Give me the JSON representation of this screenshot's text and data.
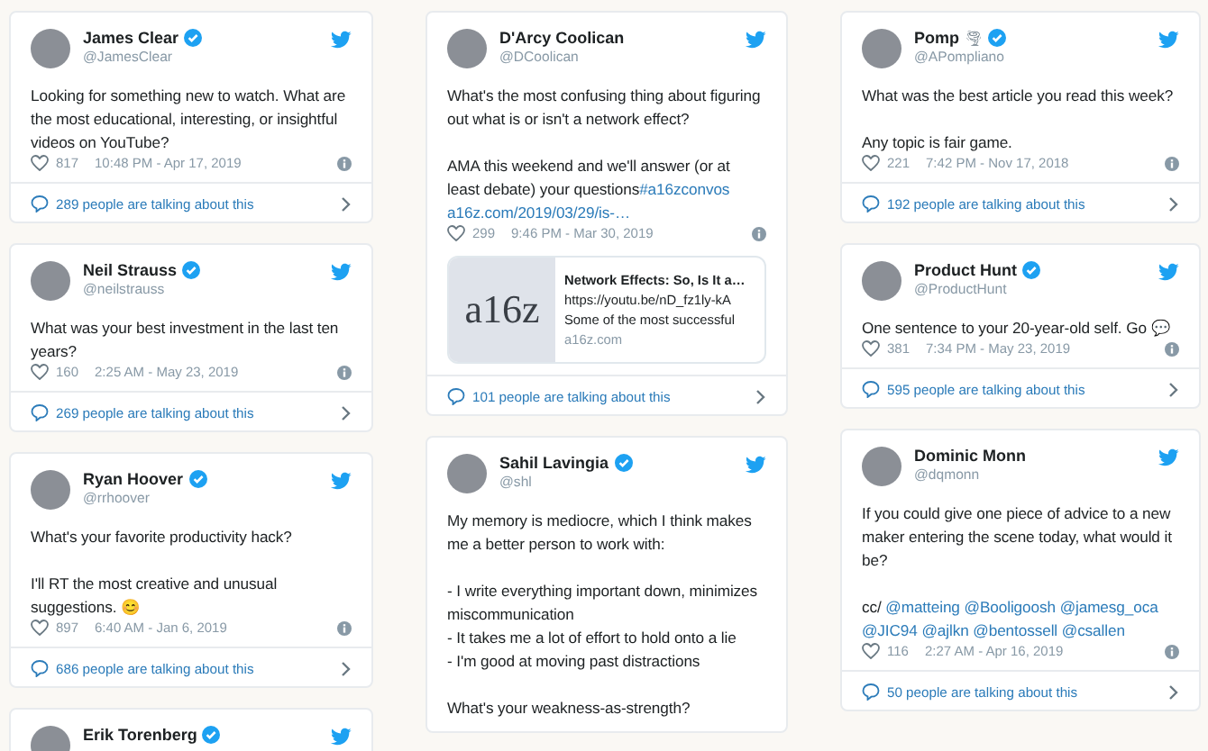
{
  "columns": [
    {
      "tweets": [
        {
          "name": "James Clear",
          "verified": true,
          "handle": "@JamesClear",
          "body": [
            {
              "kind": "text",
              "text": "Looking for something new to watch. What are the most educational, interesting, or insightful videos on YouTube?"
            }
          ],
          "likes": "817",
          "time": "10:48 PM - Apr 17, 2019",
          "talking": "289 people are talking about this"
        },
        {
          "name": "Neil Strauss",
          "verified": true,
          "handle": "@neilstrauss",
          "body": [
            {
              "kind": "text",
              "text": "What was your best investment in the last ten years?"
            }
          ],
          "likes": "160",
          "time": "2:25 AM - May 23, 2019",
          "talking": "269 people are talking about this"
        },
        {
          "name": "Ryan Hoover",
          "verified": true,
          "handle": "@rrhoover",
          "body": [
            {
              "kind": "text",
              "text": "What's your favorite productivity hack?\n\nI'll RT the most creative and unusual suggestions. 😊"
            }
          ],
          "likes": "897",
          "time": "6:40 AM - Jan 6, 2019",
          "talking": "686 people are talking about this"
        },
        {
          "name": "Erik Torenberg",
          "verified": true
        }
      ]
    },
    {
      "tweets": [
        {
          "name": "D'Arcy Coolican",
          "verified": false,
          "handle": "@DCoolican",
          "body": [
            {
              "kind": "text",
              "text": "What's the most confusing thing about figuring out what is or isn't a network effect?\n\nAMA this weekend and we'll answer (or at least debate) your questions"
            },
            {
              "kind": "link",
              "text": "#a16zconvos"
            },
            {
              "kind": "link",
              "text": "a16z.com/2019/03/29/is-…"
            }
          ],
          "likes": "299",
          "time": "9:46 PM - Mar 30, 2019",
          "link_card": {
            "image_text": "a16z",
            "title": "Network Effects: So, Is It a…",
            "url": "https://youtu.be/nD_fz1ly-kA",
            "description": "Some of the most successful",
            "domain": "a16z.com"
          },
          "talking": "101 people are talking about this"
        },
        {
          "name": "Sahil Lavingia",
          "verified": true,
          "handle": "@shl",
          "body": [
            {
              "kind": "text",
              "text": "My memory is mediocre, which I think makes me a better person to work with:\n\n- I write everything important down, minimizes miscommunication\n- It takes me a lot of effort to hold onto a lie\n- I'm good at moving past distractions\n\nWhat's your weakness-as-strength?"
            }
          ]
        }
      ]
    },
    {
      "tweets": [
        {
          "name": "Pomp",
          "name_emoji": "🌪",
          "verified": true,
          "handle": "@APompliano",
          "body": [
            {
              "kind": "text",
              "text": "What was the best article you read this week?\n\nAny topic is fair game."
            }
          ],
          "likes": "221",
          "time": "7:42 PM - Nov 17, 2018",
          "talking": "192 people are talking about this"
        },
        {
          "name": "Product Hunt",
          "verified": true,
          "handle": "@ProductHunt",
          "body": [
            {
              "kind": "text",
              "text": "One sentence to your 20-year-old self. Go 💬"
            }
          ],
          "likes": "381",
          "time": "7:34 PM - May 23, 2019",
          "talking": "595 people are talking about this"
        },
        {
          "name": "Dominic Monn",
          "verified": false,
          "handle": "@dqmonn",
          "body": [
            {
              "kind": "text",
              "text": "If you could give one piece of advice to a new maker entering the scene today, what would it be?\n\ncc/ "
            },
            {
              "kind": "link",
              "text": "@matteing"
            },
            {
              "kind": "link",
              "text": "@Booligoosh"
            },
            {
              "kind": "link",
              "text": "@jamesg_oca"
            },
            {
              "kind": "link",
              "text": "@JIC94"
            },
            {
              "kind": "link",
              "text": "@ajlkn"
            },
            {
              "kind": "link",
              "text": "@bentossell"
            },
            {
              "kind": "link",
              "text": "@csallen"
            }
          ],
          "likes": "116",
          "time": "2:27 AM - Apr 16, 2019",
          "talking": "50 people are talking about this"
        }
      ]
    }
  ]
}
